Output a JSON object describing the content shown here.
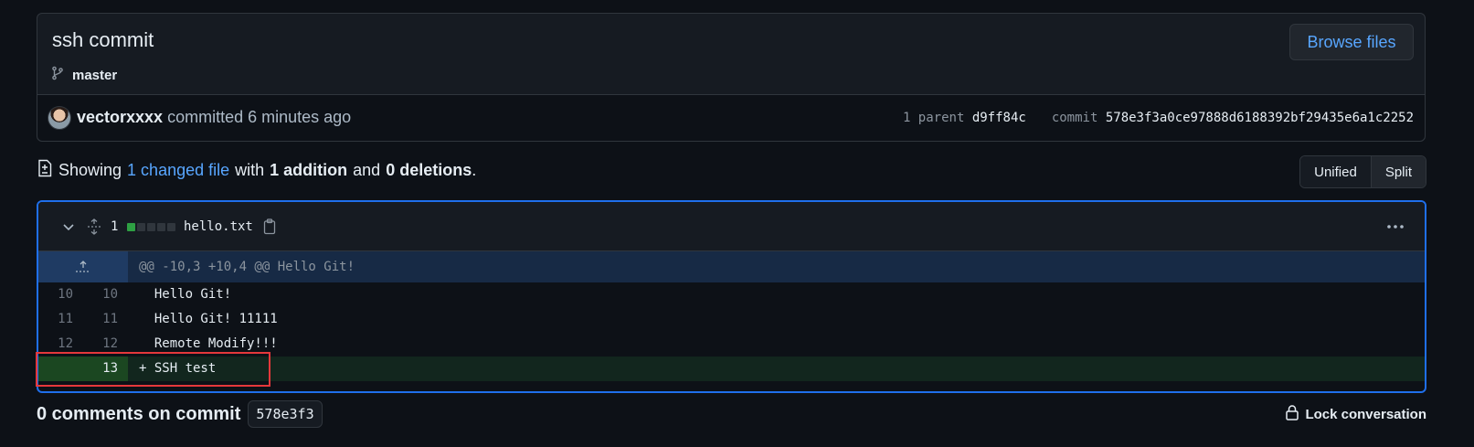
{
  "commit": {
    "title": "ssh commit",
    "branch": "master",
    "browse_label": "Browse files",
    "author": "vectorxxxx",
    "action_text": " committed 6 minutes ago",
    "parent_label": "1 parent",
    "parent_sha": "d9ff84c",
    "commit_label": "commit",
    "commit_sha": "578e3f3a0ce97888d6188392bf29435e6a1c2252"
  },
  "summary": {
    "prefix": "Showing",
    "changed": "1 changed file",
    "with": "with",
    "additions": "1 addition",
    "and": "and",
    "deletions": "0 deletions",
    "period": "."
  },
  "view_toggle": {
    "unified": "Unified",
    "split": "Split"
  },
  "file": {
    "change_count": "1",
    "diffstat_added_blocks": 1,
    "diffstat_total_blocks": 5,
    "filename": "hello.txt",
    "hunk_header": "@@ -10,3 +10,4 @@ Hello Git!",
    "lines": [
      {
        "old": "10",
        "new": "10",
        "code": "  Hello Git!"
      },
      {
        "old": "11",
        "new": "11",
        "code": "  Hello Git! 11111"
      },
      {
        "old": "12",
        "new": "12",
        "code": "  Remote Modify!!!"
      },
      {
        "old": "",
        "new": "13",
        "code": "+ SSH test",
        "type": "added"
      }
    ]
  },
  "comments": {
    "title": "0 comments on commit",
    "sha": "578e3f3",
    "lock_label": "Lock conversation"
  },
  "colors": {
    "accent": "#58a6ff",
    "added_gutter": "#1b4721",
    "added_bg": "#12261e",
    "hunk_bg": "#172a45",
    "highlight": "#e5383b"
  }
}
